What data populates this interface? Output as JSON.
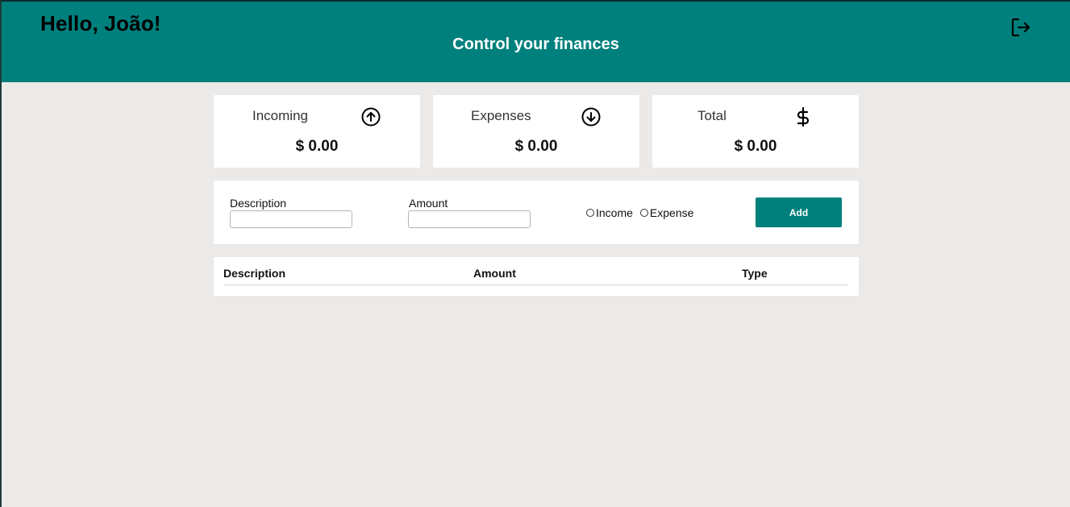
{
  "header": {
    "greeting": "Hello, João!",
    "subtitle": "Control your finances",
    "logout_icon": "logout-icon"
  },
  "summary": [
    {
      "label": "Incoming",
      "value": "$ 0.00",
      "icon": "arrow-up-circle-icon"
    },
    {
      "label": "Expenses",
      "value": "$ 0.00",
      "icon": "arrow-down-circle-icon"
    },
    {
      "label": "Total",
      "value": "$ 0.00",
      "icon": "dollar-sign-icon"
    }
  ],
  "form": {
    "description_label": "Description",
    "description_value": "",
    "amount_label": "Amount",
    "amount_value": "",
    "type_options": [
      "Income",
      "Expense"
    ],
    "add_label": "Add"
  },
  "table": {
    "columns": [
      "Description",
      "Amount",
      "Type"
    ],
    "rows": []
  },
  "colors": {
    "accent": "#00807d",
    "background": "#ebeae8",
    "panel": "#ffffff"
  }
}
